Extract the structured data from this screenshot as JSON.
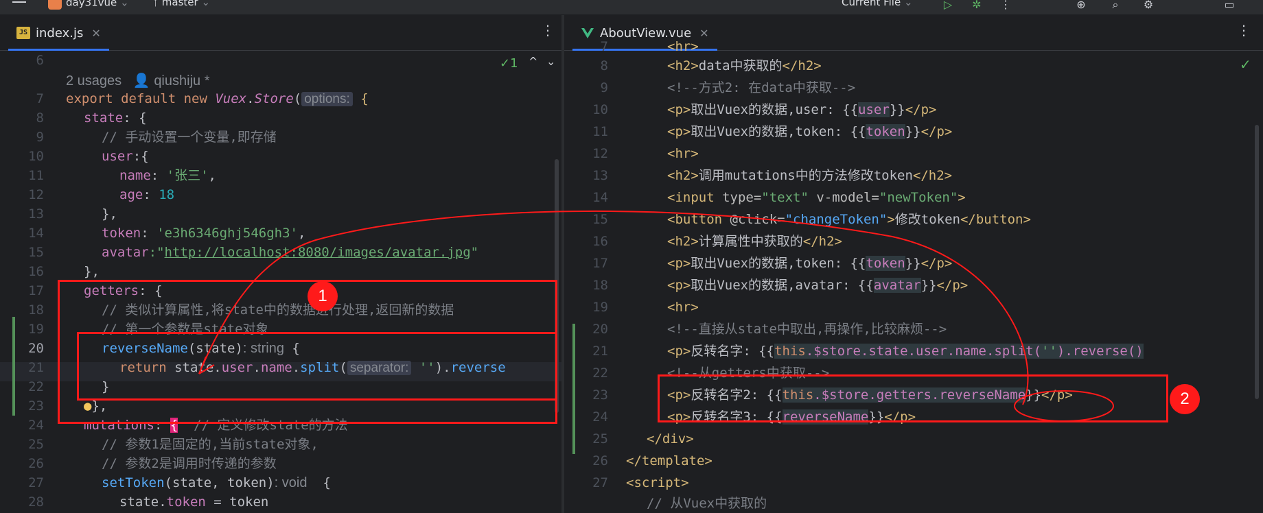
{
  "topbar": {
    "project": "day31vue",
    "branch": "master",
    "run_config": "Current File"
  },
  "left_editor": {
    "tab_label": "index.js",
    "inlay": {
      "usages": "2 usages",
      "author": "qiushiju *"
    },
    "inspections": "1",
    "lines": [
      {
        "n": "6"
      },
      {
        "n": ""
      },
      {
        "n": "7"
      },
      {
        "n": "8"
      },
      {
        "n": "9"
      },
      {
        "n": "10"
      },
      {
        "n": "11"
      },
      {
        "n": "12"
      },
      {
        "n": "13"
      },
      {
        "n": "14"
      },
      {
        "n": "15"
      },
      {
        "n": "16"
      },
      {
        "n": "17"
      },
      {
        "n": "18"
      },
      {
        "n": "19"
      },
      {
        "n": "20"
      },
      {
        "n": "21"
      },
      {
        "n": "22"
      },
      {
        "n": "23"
      },
      {
        "n": "24"
      },
      {
        "n": "25"
      },
      {
        "n": "26"
      },
      {
        "n": "27"
      },
      {
        "n": "28"
      }
    ],
    "code": {
      "l7": {
        "a": "export default new ",
        "b": "Vuex",
        "c": ".",
        "d": "Store",
        "e": "(",
        "hint": "options:",
        "f": " {"
      },
      "l8": {
        "a": "state",
        "b": ": {"
      },
      "l9": "// 手动设置一个变量,即存储",
      "l10": {
        "a": "user",
        "b": ":{"
      },
      "l11": {
        "a": "name",
        "b": ": ",
        "c": "'张三'",
        "d": ","
      },
      "l12": {
        "a": "age",
        "b": ": ",
        "c": "18"
      },
      "l13": "},",
      "l14": {
        "a": "token",
        "b": ": ",
        "c": "'e3h6346ghj546gh3'",
        "d": ","
      },
      "l15": {
        "a": "avatar",
        "b": ":\"",
        "c": "http://localhost:8080/images/avatar.jpg",
        "d": "\""
      },
      "l16": "},",
      "l17": {
        "a": "getters",
        "b": ": {"
      },
      "l18": "// 类似计算属性,将state中的数据进行处理,返回新的数据",
      "l19": "// 第一个参数是state对象",
      "l20": {
        "a": "reverseName",
        "b": "(state)",
        "hint": ": string",
        "c": " {"
      },
      "l21": {
        "a": "return ",
        "b": "state.",
        "c": "user",
        "d": ".",
        "e": "name",
        "f": ".",
        "g": "split",
        "h": "(",
        "hint": "separator:",
        "i": " ''",
        "j": ").",
        "k": "reverse"
      },
      "l22": "}",
      "l23": "},",
      "l24": {
        "a": "mutations",
        "b": ": ",
        "c": "{",
        "d": "  // 定义修改state的方法"
      },
      "l25": "// 参数1是固定的,当前state对象,",
      "l26": "// 参数2是调用时传递的参数",
      "l27": {
        "a": "setToken",
        "b": "(state, token)",
        "hint": ": void",
        "c": "  {"
      },
      "l28": {
        "a": "state.",
        "b": "token",
        "c": " = token"
      }
    }
  },
  "right_editor": {
    "tab_label": "AboutView.vue",
    "lines": [
      {
        "n": "7"
      },
      {
        "n": "8"
      },
      {
        "n": "9"
      },
      {
        "n": "10"
      },
      {
        "n": "11"
      },
      {
        "n": "12"
      },
      {
        "n": "13"
      },
      {
        "n": "14"
      },
      {
        "n": "15"
      },
      {
        "n": "16"
      },
      {
        "n": "17"
      },
      {
        "n": "18"
      },
      {
        "n": "19"
      },
      {
        "n": "20"
      },
      {
        "n": "21"
      },
      {
        "n": "22"
      },
      {
        "n": "23"
      },
      {
        "n": "24"
      },
      {
        "n": "25"
      },
      {
        "n": "26"
      },
      {
        "n": "27"
      }
    ],
    "code": {
      "l7": "<hr>",
      "l8": {
        "a": "<h2>",
        "b": "data中获取的",
        "c": "</h2>"
      },
      "l9": "<!--方式2: 在data中获取-->",
      "l10": {
        "a": "<p>",
        "b": "取出Vuex的数据,user: {{",
        "c": "user",
        "d": "}}",
        "e": "</p>"
      },
      "l11": {
        "a": "<p>",
        "b": "取出Vuex的数据,token: {{",
        "c": "token",
        "d": "}}",
        "e": "</p>"
      },
      "l12": "<hr>",
      "l13": {
        "a": "<h2>",
        "b": "调用mutations中的方法修改token",
        "c": "</h2>"
      },
      "l14": {
        "a": "<input ",
        "b": "type=",
        "c": "\"text\"",
        "d": " v-model=",
        "e": "\"newToken\"",
        "f": ">"
      },
      "l15": {
        "a": "<button ",
        "b": "@click=",
        "c": "\"changeToken\"",
        "d": ">",
        "e": "修改token",
        "f": "</button>"
      },
      "l16": {
        "a": "<h2>",
        "b": "计算属性中获取的",
        "c": "</h2>"
      },
      "l17": {
        "a": "<p>",
        "b": "取出Vuex的数据,token: {{",
        "c": "token",
        "d": "}}",
        "e": "</p>"
      },
      "l18": {
        "a": "<p>",
        "b": "取出Vuex的数据,avatar: {{",
        "c": "avatar",
        "d": "}}",
        "e": "</p>"
      },
      "l19": "<hr>",
      "l20": "<!--直接从state中取出,再操作,比较麻烦-->",
      "l21": {
        "a": "<p>",
        "b": "反转名字: {{",
        "c": "this",
        "d": ".$store.state.user.name.split(",
        "e": "''",
        "f": ").reverse()"
      },
      "l22": "<!--从getters中获取-->",
      "l23": {
        "a": "<p>",
        "b": "反转名字2: {{",
        "c": "this",
        "d": ".$store.getters.reverseName",
        "e": "}}",
        "f": "</p>"
      },
      "l24": {
        "a": "<p>",
        "b": "反转名字3: {{",
        "c": "reverseName",
        "d": "}}",
        "e": "</p>"
      },
      "l25": "</div>",
      "l26": "</template>",
      "l27": "<script>",
      "l28": "// 从Vuex中获取的"
    }
  },
  "annotations": [
    {
      "label": "1"
    },
    {
      "label": "2"
    }
  ],
  "colors": {
    "accent": "#3574f0",
    "annotation_red": "#ff1a1a",
    "change_green": "#549159"
  }
}
